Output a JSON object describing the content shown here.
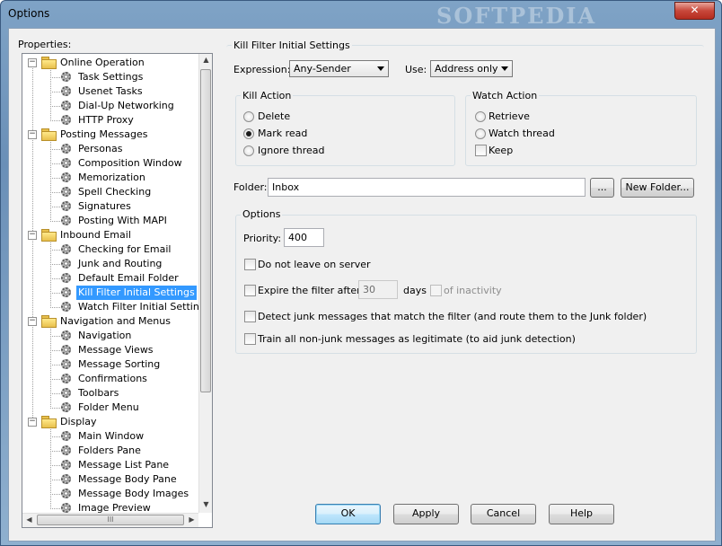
{
  "window": {
    "title": "Options",
    "watermark": "SOFTPEDIA",
    "close_glyph": "✕"
  },
  "sidebar": {
    "label": "Properties:",
    "tree": [
      {
        "label": "Online Operation",
        "level": 0,
        "icon": "folder-icon"
      },
      {
        "label": "Task Settings",
        "level": 1,
        "icon": "gear-icon"
      },
      {
        "label": "Usenet Tasks",
        "level": 1,
        "icon": "gear-icon"
      },
      {
        "label": "Dial-Up Networking",
        "level": 1,
        "icon": "gear-icon"
      },
      {
        "label": "HTTP Proxy",
        "level": 1,
        "icon": "gear-icon"
      },
      {
        "label": "Posting Messages",
        "level": 0,
        "icon": "folder-icon"
      },
      {
        "label": "Personas",
        "level": 1,
        "icon": "gear-icon"
      },
      {
        "label": "Composition Window",
        "level": 1,
        "icon": "gear-icon"
      },
      {
        "label": "Memorization",
        "level": 1,
        "icon": "gear-icon"
      },
      {
        "label": "Spell Checking",
        "level": 1,
        "icon": "gear-icon"
      },
      {
        "label": "Signatures",
        "level": 1,
        "icon": "gear-icon"
      },
      {
        "label": "Posting With MAPI",
        "level": 1,
        "icon": "gear-icon"
      },
      {
        "label": "Inbound Email",
        "level": 0,
        "icon": "folder-icon"
      },
      {
        "label": "Checking for Email",
        "level": 1,
        "icon": "gear-icon"
      },
      {
        "label": "Junk and Routing",
        "level": 1,
        "icon": "gear-icon"
      },
      {
        "label": "Default Email Folder",
        "level": 1,
        "icon": "gear-icon"
      },
      {
        "label": "Kill Filter Initial Settings",
        "level": 1,
        "icon": "gear-icon",
        "selected": true
      },
      {
        "label": "Watch Filter Initial Settings",
        "level": 1,
        "icon": "gear-icon"
      },
      {
        "label": "Navigation and Menus",
        "level": 0,
        "icon": "folder-icon"
      },
      {
        "label": "Navigation",
        "level": 1,
        "icon": "gear-icon"
      },
      {
        "label": "Message Views",
        "level": 1,
        "icon": "gear-icon"
      },
      {
        "label": "Message Sorting",
        "level": 1,
        "icon": "gear-icon"
      },
      {
        "label": "Confirmations",
        "level": 1,
        "icon": "gear-icon"
      },
      {
        "label": "Toolbars",
        "level": 1,
        "icon": "gear-icon"
      },
      {
        "label": "Folder Menu",
        "level": 1,
        "icon": "gear-icon"
      },
      {
        "label": "Display",
        "level": 0,
        "icon": "folder-icon"
      },
      {
        "label": "Main Window",
        "level": 1,
        "icon": "gear-icon"
      },
      {
        "label": "Folders Pane",
        "level": 1,
        "icon": "gear-icon"
      },
      {
        "label": "Message List Pane",
        "level": 1,
        "icon": "gear-icon"
      },
      {
        "label": "Message Body Pane",
        "level": 1,
        "icon": "gear-icon"
      },
      {
        "label": "Message Body Images",
        "level": 1,
        "icon": "gear-icon"
      },
      {
        "label": "Image Preview",
        "level": 1,
        "icon": "gear-icon"
      }
    ],
    "hscroll_grip": "III"
  },
  "panel": {
    "title": "Kill Filter Initial Settings",
    "expression_label": "Expression:",
    "expression_value": "Any-Sender",
    "use_label": "Use:",
    "use_value": "Address only",
    "kill_action": {
      "title": "Kill Action",
      "options": [
        "Delete",
        "Mark read",
        "Ignore thread"
      ],
      "selected": "Mark read"
    },
    "watch_action": {
      "title": "Watch Action",
      "retrieve": "Retrieve",
      "watch_thread": "Watch thread",
      "keep": "Keep"
    },
    "folder_label": "Folder:",
    "folder_value": "Inbox",
    "browse_label": "...",
    "new_folder_label": "New Folder...",
    "options": {
      "title": "Options",
      "priority_label": "Priority:",
      "priority_value": "400",
      "do_not_leave": "Do not leave on server",
      "expire_label": "Expire the filter after",
      "expire_days_value": "30",
      "days_label": "days",
      "of_inactivity": "of inactivity",
      "detect_junk": "Detect junk messages that match the filter (and route them to the Junk folder)",
      "train_nonjunk": "Train all non-junk messages as legitimate (to aid junk detection)"
    }
  },
  "buttons": {
    "ok": "OK",
    "apply": "Apply",
    "cancel": "Cancel",
    "help": "Help"
  }
}
